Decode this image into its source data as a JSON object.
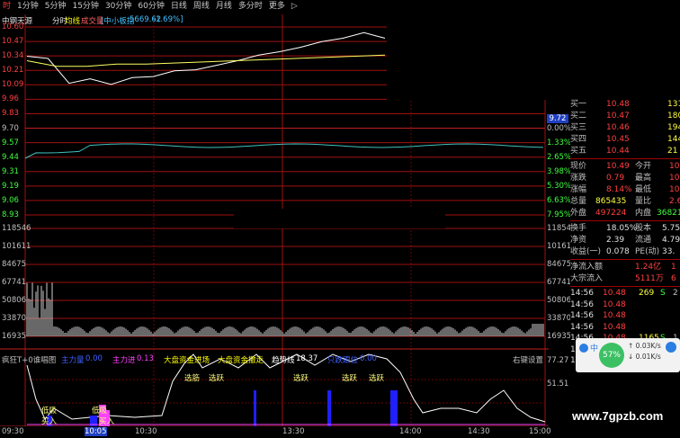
{
  "periodbar": {
    "items": [
      "时",
      "1分钟",
      "5分钟",
      "15分钟",
      "30分钟",
      "60分钟",
      "日线",
      "周线",
      "月线",
      "多分时",
      "更多"
    ],
    "active_index": 0,
    "more_arrow": "▷"
  },
  "header": {
    "stock": "中钢天源",
    "mode": "分时",
    "avg_label": "均线",
    "vol_label": "成交量",
    "index_label": "[中小板指",
    "index_value": "5669.62",
    "index_change": "-1.69%]"
  },
  "price_axis": {
    "left": [
      "10.60",
      "10.47",
      "10.34",
      "10.21",
      "10.09",
      "9.96",
      "9.83",
      "9.70",
      "9.57",
      "9.44",
      "9.31",
      "9.19",
      "9.06",
      "8.93"
    ],
    "right_pct": [
      "",
      "",
      "",
      "",
      "",
      "",
      "",
      "",
      "1.33%",
      "2.65%",
      "3.98%",
      "5.30%",
      "6.63%",
      "7.95%"
    ],
    "right_zero": "0.00%",
    "right_flag": "9.72"
  },
  "volume_axis": {
    "left": [
      "118546",
      "101611",
      "84675",
      "67741",
      "50806",
      "33870",
      "16935"
    ],
    "right": [
      "118546",
      "101611",
      "84675",
      "67741",
      "50806",
      "33870",
      "16935"
    ]
  },
  "indicator": {
    "title": "疯狂T+0谁唱图",
    "items": [
      {
        "label": "主力量",
        "value": "0.00",
        "color": "#4060ff"
      },
      {
        "label": "主力进",
        "value": "0.13",
        "color": "#ff40ff"
      },
      {
        "label": "大盘资金进场",
        "value": "",
        "color": "#ffff00"
      },
      {
        "label": "大盘资金撤走",
        "value": "",
        "color": "#ffff00"
      },
      {
        "label": "趋势线",
        "value": "18.37",
        "color": "#ffffff"
      },
      {
        "label": "只跌跟位",
        "value": "0.00",
        "color": "#4060ff"
      }
    ],
    "settings": "右键设置",
    "axis": [
      "77.27",
      "51.51"
    ],
    "tags": [
      "选筋",
      "选跃",
      "选跃",
      "选跃",
      "选跃"
    ],
    "buy_tags": [
      "低吸",
      "买入",
      "低吸",
      "买入"
    ]
  },
  "timeaxis": [
    "09:30",
    "10:05",
    "10:30",
    "13:30",
    "14:00",
    "14:30",
    "15:00"
  ],
  "quote": {
    "bids": [
      {
        "name": "买一",
        "price": "10.48",
        "vol": "131"
      },
      {
        "name": "买二",
        "price": "10.47",
        "vol": "180"
      },
      {
        "name": "买三",
        "price": "10.46",
        "vol": "194"
      },
      {
        "name": "买四",
        "price": "10.45",
        "vol": "144"
      },
      {
        "name": "买五",
        "price": "10.44",
        "vol": "21"
      }
    ],
    "stats": [
      {
        "k": "现价",
        "v": "10.49",
        "k2": "今开",
        "v2": "10.2"
      },
      {
        "k": "涨跌",
        "v": "0.79",
        "k2": "最高",
        "v2": "10.6"
      },
      {
        "k": "涨幅",
        "v": "8.14%",
        "k2": "最低",
        "v2": "10.0"
      },
      {
        "k": "总量",
        "v": "865435",
        "k2": "量比",
        "v2": "2.6"
      },
      {
        "k": "外盘",
        "v": "497224",
        "k2": "内盘",
        "v2": "36821"
      }
    ],
    "stats2": [
      {
        "k": "换手",
        "v": "18.05%",
        "k2": "股本",
        "v2": "5.75亿"
      },
      {
        "k": "净资",
        "v": "2.39",
        "k2": "流通",
        "v2": "4.79亿"
      },
      {
        "k": "收益(一)",
        "v": "0.078",
        "k2": "PE(动)",
        "v2": "33."
      }
    ],
    "flows": [
      {
        "k": "净流入额",
        "v": "1.24亿",
        "x": "1"
      },
      {
        "k": "大宗流入",
        "v": "5111万",
        "x": "6"
      }
    ],
    "ticks": [
      {
        "t": "14:56",
        "p": "10.48",
        "v": "269",
        "d": "S",
        "n": "2"
      },
      {
        "t": "14:56",
        "p": "10.48",
        "v": "",
        "d": "",
        "n": ""
      },
      {
        "t": "14:56",
        "p": "10.48",
        "v": "",
        "d": "",
        "n": ""
      },
      {
        "t": "14:56",
        "p": "10.48",
        "v": "",
        "d": "",
        "n": ""
      },
      {
        "t": "14:56",
        "p": "10.48",
        "v": "1165",
        "d": "S",
        "n": "1"
      },
      {
        "t": "14:56",
        "p": "10.49",
        "v": "71",
        "d": "B",
        "n": ""
      },
      {
        "t": "14:56",
        "p": "10.48",
        "v": "343",
        "d": "S",
        "n": "2"
      }
    ]
  },
  "widget": {
    "pct": "57%",
    "up": "0.03K/s",
    "down": "0.01K/s",
    "letter": "中"
  },
  "watermark": "www.7gpzb.com",
  "chart_data": {
    "type": "line",
    "series": [
      {
        "values": [
          10.34,
          10.32,
          10.1,
          10.14,
          10.09,
          10.15,
          10.16,
          10.21,
          10.22,
          10.26,
          10.3,
          10.35,
          10.38,
          10.42,
          10.47,
          10.5,
          10.55,
          10.5
        ]
      },
      {
        "values": [
          10.3,
          10.25,
          10.25,
          10.27,
          10.27,
          10.28,
          10.29,
          10.3,
          10.31,
          10.32,
          10.33,
          10.34,
          10.35
        ]
      }
    ],
    "ylim": [
      8.93,
      10.6
    ]
  }
}
